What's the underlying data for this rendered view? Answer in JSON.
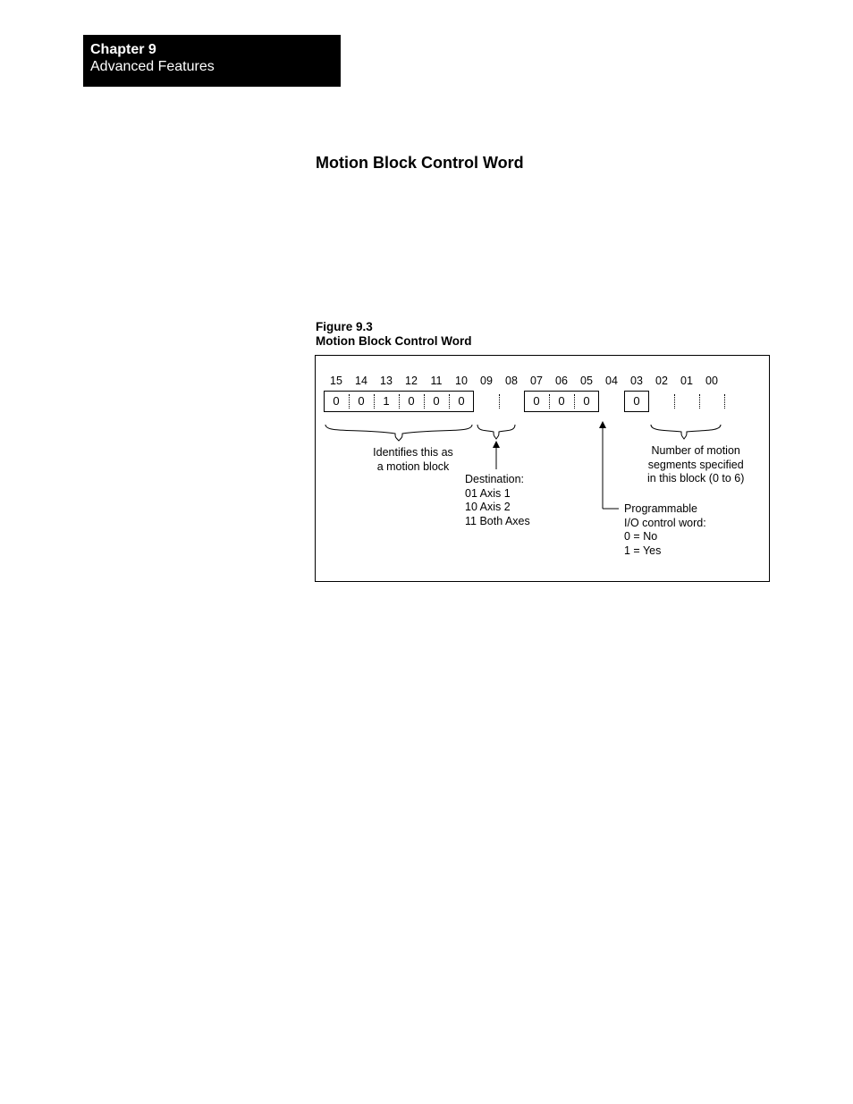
{
  "header": {
    "chapter": "Chapter 9",
    "title": "Advanced Features"
  },
  "section_heading": "Motion Block Control Word",
  "figure": {
    "number": "Figure 9.3",
    "title": "Motion Block Control Word"
  },
  "bits": {
    "labels": [
      "15",
      "14",
      "13",
      "12",
      "11",
      "10",
      "09",
      "08",
      "07",
      "06",
      "05",
      "04",
      "03",
      "02",
      "01",
      "00"
    ],
    "values": [
      "0",
      "0",
      "1",
      "0",
      "0",
      "0",
      "",
      "",
      "0",
      "0",
      "0",
      "",
      "0",
      "",
      "",
      ""
    ]
  },
  "annotations": {
    "identify": {
      "line1": "Identifies this as",
      "line2": "a motion block"
    },
    "destination": {
      "title": "Destination:",
      "row1": "01  Axis 1",
      "row2": "10  Axis 2",
      "row3": "11  Both Axes"
    },
    "io": {
      "l1": "Programmable",
      "l2": "I/O control word:",
      "l3": "0 = No",
      "l4": "1 = Yes"
    },
    "segments": {
      "l1": "Number of motion",
      "l2": "segments specified",
      "l3": "in this block (0 to 6)"
    }
  }
}
